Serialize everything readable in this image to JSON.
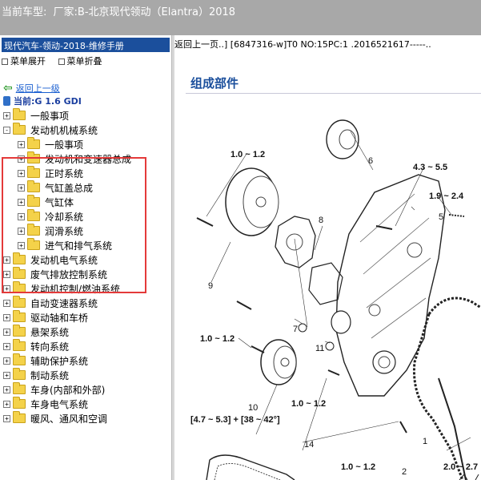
{
  "topbar": {
    "label": "当前车型:",
    "value": "厂家:B-北京现代领动（Elantra）2018"
  },
  "left": {
    "manual_title": "现代汽车-领动-2018-维修手册",
    "expand_label": "菜单展开",
    "collapse_label": "菜单折叠",
    "back_label": "返回上一级",
    "current_label": "当前:G 1.6 GDI",
    "tree": [
      {
        "label": "一般事项",
        "level": 0,
        "expander": "+"
      },
      {
        "label": "发动机机械系统",
        "level": 0,
        "expander": "-",
        "open": true
      },
      {
        "label": "一般事项",
        "level": 1,
        "expander": "+"
      },
      {
        "label": "发动机和变速器总成",
        "level": 1,
        "expander": "+"
      },
      {
        "label": "正时系统",
        "level": 1,
        "expander": "+"
      },
      {
        "label": "气缸盖总成",
        "level": 1,
        "expander": "+"
      },
      {
        "label": "气缸体",
        "level": 1,
        "expander": "+"
      },
      {
        "label": "冷却系统",
        "level": 1,
        "expander": "+"
      },
      {
        "label": "润滑系统",
        "level": 1,
        "expander": "+"
      },
      {
        "label": "进气和排气系统",
        "level": 1,
        "expander": "+"
      },
      {
        "label": "发动机电气系统",
        "level": 0,
        "expander": "+"
      },
      {
        "label": "废气排放控制系统",
        "level": 0,
        "expander": "+"
      },
      {
        "label": "发动机控制/燃油系统",
        "level": 0,
        "expander": "+"
      },
      {
        "label": "自动变速器系统",
        "level": 0,
        "expander": "+"
      },
      {
        "label": "驱动轴和车桥",
        "level": 0,
        "expander": "+"
      },
      {
        "label": "悬架系统",
        "level": 0,
        "expander": "+"
      },
      {
        "label": "转向系统",
        "level": 0,
        "expander": "+"
      },
      {
        "label": "辅助保护系统",
        "level": 0,
        "expander": "+"
      },
      {
        "label": "制动系统",
        "level": 0,
        "expander": "+"
      },
      {
        "label": "车身(内部和外部)",
        "level": 0,
        "expander": "+"
      },
      {
        "label": "车身电气系统",
        "level": 0,
        "expander": "+"
      },
      {
        "label": "暖风、通风和空调",
        "level": 0,
        "expander": "+"
      }
    ]
  },
  "right": {
    "path": "返回上一页..] [6847316-w]T0 NO:15PC:1 .2016521617-----..",
    "section_title": "组成部件",
    "torques": {
      "t1": "1.0 ~ 1.2",
      "t2": "4.3 ~ 5.5",
      "t3": "1.9 ~ 2.4",
      "t4": "1.0 ~ 1.2",
      "t5": "1.0 ~ 1.2",
      "t6": "[4.7 ~ 5.3] + [38 ~ 42°]",
      "t7": "1.0 ~ 1.2",
      "t8": "2.0 ~ 2.7"
    },
    "part_numbers": [
      "1",
      "2",
      "5",
      "6",
      "7",
      "8",
      "9",
      "10",
      "11",
      "14"
    ]
  },
  "colors": {
    "topbar": "#a8a8a8",
    "title_bar": "#1b4f9c",
    "highlight": "#e43a3a",
    "section_title": "#1b4f9c"
  }
}
